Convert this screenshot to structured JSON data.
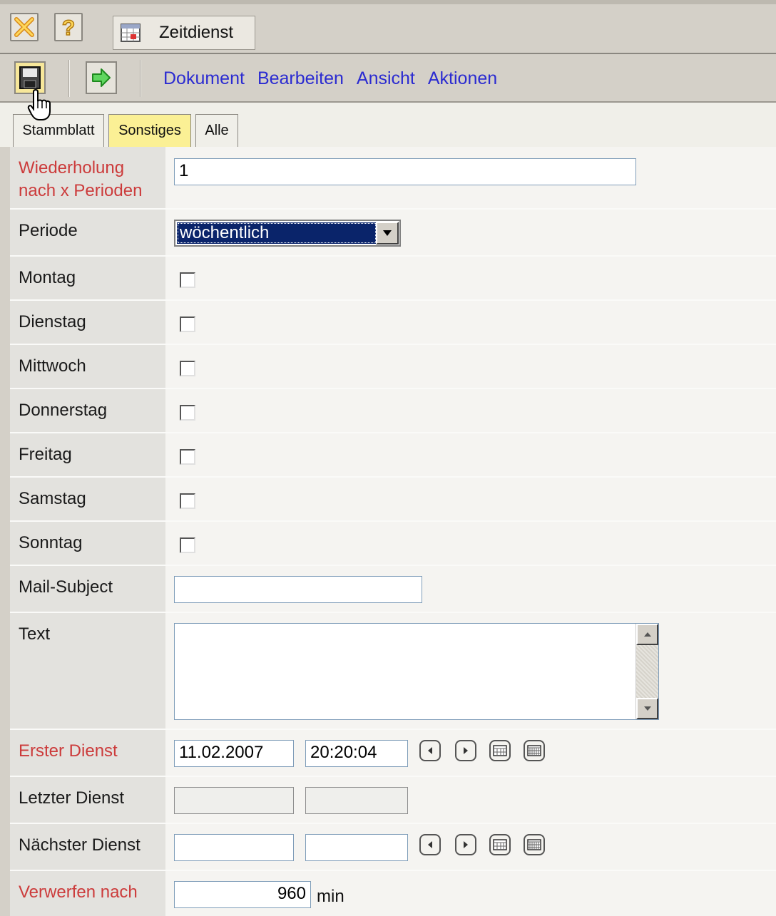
{
  "titlebar": {
    "window_tab": "Zeitdienst",
    "icons": [
      "close-icon",
      "help-icon",
      "document-icon"
    ]
  },
  "toolbar": {
    "icons": [
      "save-icon",
      "forward-icon"
    ],
    "menu": [
      "Dokument",
      "Bearbeiten",
      "Ansicht",
      "Aktionen"
    ]
  },
  "tabs": [
    {
      "label": "Stammblatt",
      "active": false
    },
    {
      "label": "Sonstiges",
      "active": true
    },
    {
      "label": "Alle",
      "active": false
    }
  ],
  "form": {
    "wiederholung": {
      "label": "Wiederholung nach x Perioden",
      "value": "1"
    },
    "periode": {
      "label": "Periode",
      "value": "wöchentlich"
    },
    "days": [
      {
        "label": "Montag",
        "checked": false
      },
      {
        "label": "Dienstag",
        "checked": false
      },
      {
        "label": "Mittwoch",
        "checked": false
      },
      {
        "label": "Donnerstag",
        "checked": false
      },
      {
        "label": "Freitag",
        "checked": false
      },
      {
        "label": "Samstag",
        "checked": false
      },
      {
        "label": "Sonntag",
        "checked": false
      }
    ],
    "mail_subject": {
      "label": "Mail-Subject",
      "value": ""
    },
    "text": {
      "label": "Text",
      "value": ""
    },
    "erster_dienst": {
      "label": "Erster Dienst",
      "date": "11.02.2007",
      "time": "20:20:04"
    },
    "letzter_dienst": {
      "label": "Letzter Dienst",
      "date": "",
      "time": ""
    },
    "naechster_dienst": {
      "label": "Nächster Dienst",
      "date": "",
      "time": ""
    },
    "verwerfen": {
      "label": "Verwerfen nach",
      "value": "960",
      "unit": "min"
    }
  },
  "colors": {
    "required_label": "#cc3b3b",
    "menu_link": "#2b2bd1",
    "active_tab": "#fbf095",
    "selection": "#0a246a"
  }
}
